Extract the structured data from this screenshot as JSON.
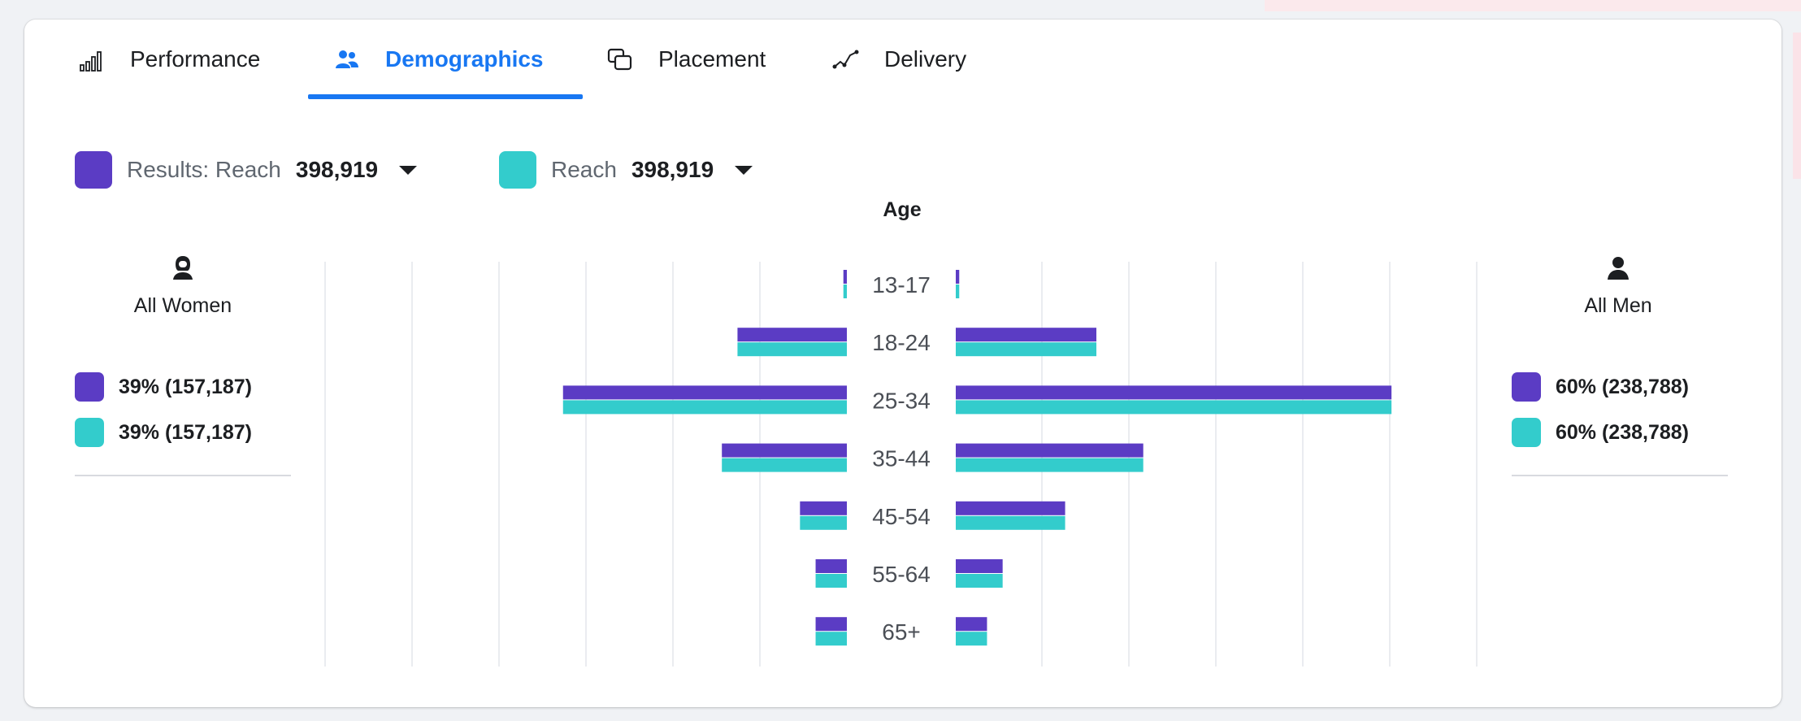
{
  "tabs": [
    {
      "label": "Performance",
      "icon": "bar-chart-icon",
      "active": false
    },
    {
      "label": "Demographics",
      "icon": "people-icon",
      "active": true
    },
    {
      "label": "Placement",
      "icon": "placement-icon",
      "active": false
    },
    {
      "label": "Delivery",
      "icon": "delivery-icon",
      "active": false
    }
  ],
  "metrics": [
    {
      "label": "Results: Reach",
      "value": "398,919",
      "color": "#5b3cc4"
    },
    {
      "label": "Reach",
      "value": "398,919",
      "color": "#33cccc"
    }
  ],
  "chart_title": "Age",
  "women": {
    "icon": "woman-icon",
    "title": "All Women",
    "stats": [
      "39% (157,187)",
      "39% (157,187)"
    ]
  },
  "men": {
    "icon": "man-icon",
    "title": "All Men",
    "stats": [
      "60% (238,788)",
      "60% (238,788)"
    ]
  },
  "colors": {
    "results": "#5b3cc4",
    "reach": "#33cccc",
    "active_tab": "#1877f2"
  },
  "chart_data": {
    "type": "bar",
    "orientation": "horizontal-population-pyramid",
    "categories": [
      "13-17",
      "18-24",
      "25-34",
      "35-44",
      "45-54",
      "55-64",
      "65+"
    ],
    "xlabel": "Age",
    "series": [
      {
        "name": "Results: Reach",
        "side": "women",
        "values": [
          0.4,
          12.6,
          32.7,
          14.4,
          5.4,
          3.6,
          3.6
        ]
      },
      {
        "name": "Reach",
        "side": "women",
        "values": [
          0.4,
          12.6,
          32.7,
          14.4,
          5.4,
          3.6,
          3.6
        ]
      },
      {
        "name": "Results: Reach",
        "side": "men",
        "values": [
          0.4,
          16.2,
          50.2,
          21.6,
          12.6,
          5.4,
          3.6
        ]
      },
      {
        "name": "Reach",
        "side": "men",
        "values": [
          0.4,
          16.2,
          50.2,
          21.6,
          12.6,
          5.4,
          3.6
        ]
      }
    ],
    "grid": true
  }
}
